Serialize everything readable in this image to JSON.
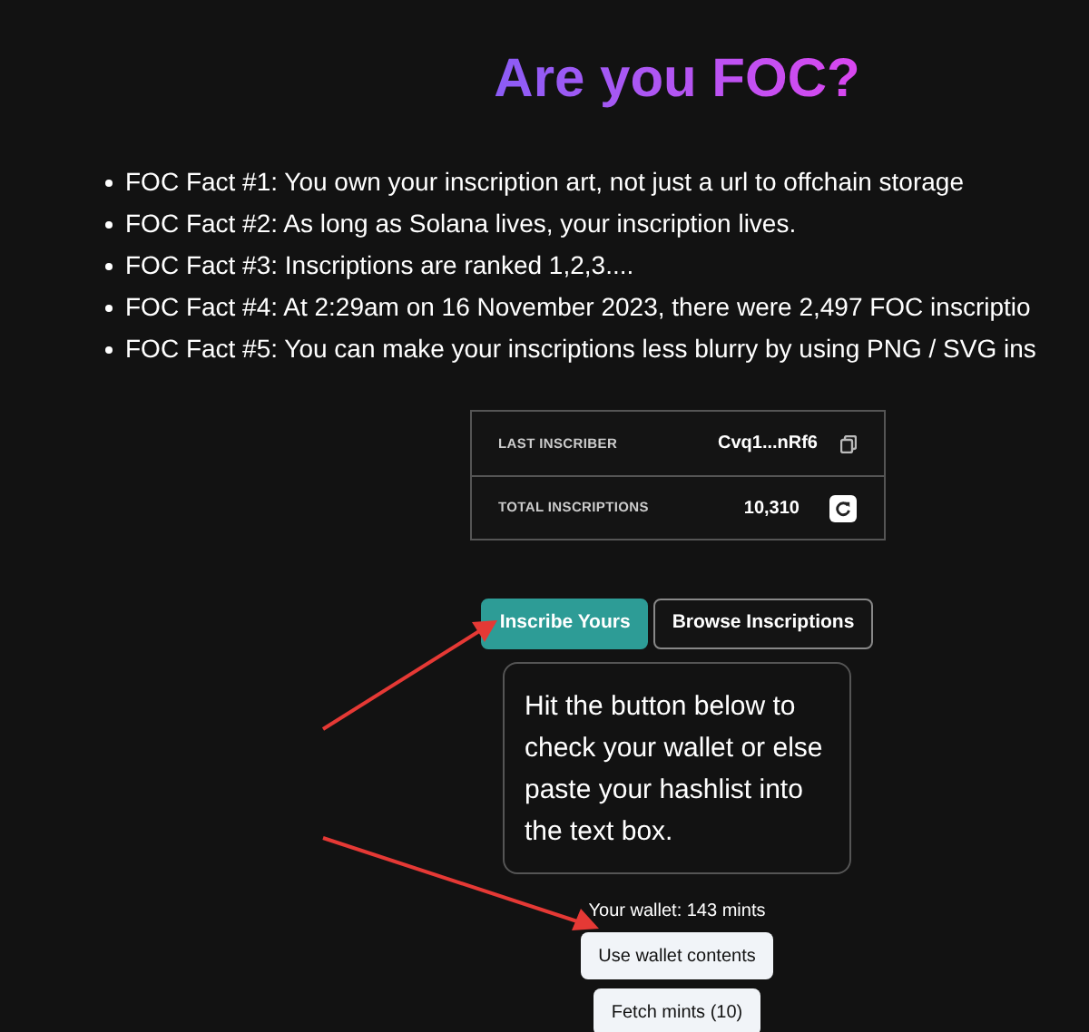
{
  "title": "Are you FOC?",
  "facts": [
    "FOC Fact #1: You own your inscription art, not just a url to offchain storage",
    "FOC Fact #2: As long as Solana lives, your inscription lives.",
    "FOC Fact #3: Inscriptions are ranked 1,2,3....",
    "FOC Fact #4: At 2:29am on 16 November 2023, there were 2,497 FOC inscriptio",
    "FOC Fact #5: You can make your inscriptions less blurry by using PNG / SVG ins"
  ],
  "stats": [
    {
      "label": "LAST INSCRIBER",
      "value": "Cvq1...nRf6",
      "kind": "copy"
    },
    {
      "label": "TOTAL INSCRIPTIONS",
      "value": "10,310",
      "kind": "refresh"
    }
  ],
  "tabs": [
    {
      "label": "Inscribe Yours",
      "selected": true
    },
    {
      "label": "Browse Inscriptions",
      "selected": false
    }
  ],
  "instructions": "Hit the button below to check your wallet or else paste your hashlist into the text box.",
  "wallet_summary": "Your wallet: 143 mints",
  "buttons": [
    "Use wallet contents",
    "Fetch mints (10)"
  ]
}
